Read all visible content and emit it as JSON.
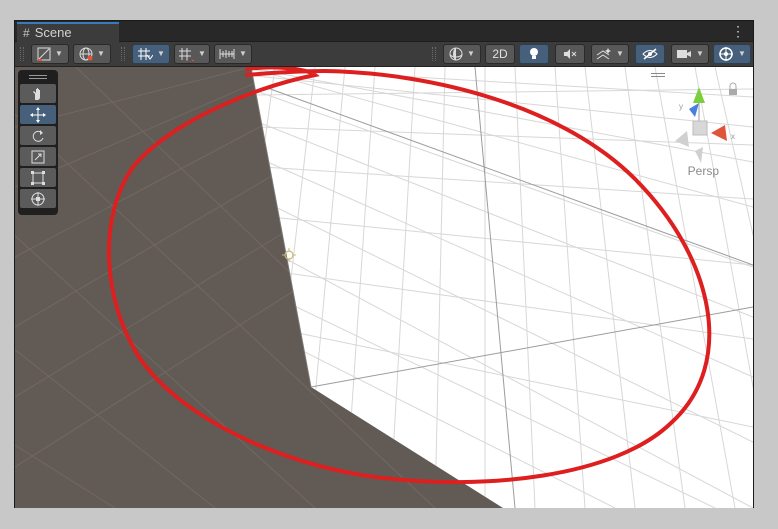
{
  "window": {
    "tab_title": "Scene",
    "tab_icon": "grid-icon",
    "menu_icon": "kebab-menu-icon"
  },
  "toolbar": {
    "left_items": [
      {
        "name": "draw-mode",
        "icon": "shaded-draw-icon",
        "dropdown": true
      },
      {
        "name": "render-mode",
        "icon": "globe-icon",
        "dropdown": true
      },
      {
        "name": "grid-toggle",
        "icon": "grid-snap-icon",
        "dropdown": true,
        "active": true
      },
      {
        "name": "increment-snap",
        "icon": "snap-icon",
        "dropdown": true
      },
      {
        "name": "ruler",
        "icon": "ruler-icon",
        "dropdown": true
      }
    ],
    "right_items": [
      {
        "name": "orientation",
        "icon": "sphere-icon",
        "dropdown": true
      },
      {
        "name": "mode-2d",
        "label": "2D"
      },
      {
        "name": "lighting",
        "icon": "lightbulb-icon",
        "active": true
      },
      {
        "name": "audio",
        "icon": "speaker-mute-icon"
      },
      {
        "name": "effects",
        "icon": "effects-icon",
        "dropdown": true
      },
      {
        "name": "visibility",
        "icon": "eye-hidden-icon",
        "active": true
      },
      {
        "name": "camera",
        "icon": "camera-icon",
        "dropdown": true
      },
      {
        "name": "gizmos",
        "icon": "gizmo-icon",
        "dropdown": true,
        "active": true
      }
    ]
  },
  "tools": [
    {
      "name": "hand-tool",
      "icon": "hand-icon",
      "selected": false
    },
    {
      "name": "move-tool",
      "icon": "move-icon",
      "selected": true
    },
    {
      "name": "rotate-tool",
      "icon": "rotate-icon",
      "selected": false
    },
    {
      "name": "scale-tool",
      "icon": "scale-icon",
      "selected": false
    },
    {
      "name": "rect-tool",
      "icon": "rect-transform-icon",
      "selected": false
    },
    {
      "name": "transform-tool",
      "icon": "transform-icon",
      "selected": false
    }
  ],
  "gizmo": {
    "projection_label": "Persp"
  },
  "colors": {
    "ground": "#625a54",
    "plane": "#ffffff",
    "annotation": "#dd1f1f",
    "accent": "#46607c",
    "axis_x": "#e0553a",
    "axis_y": "#7ccf3a",
    "axis_z": "#4a7fe0"
  }
}
